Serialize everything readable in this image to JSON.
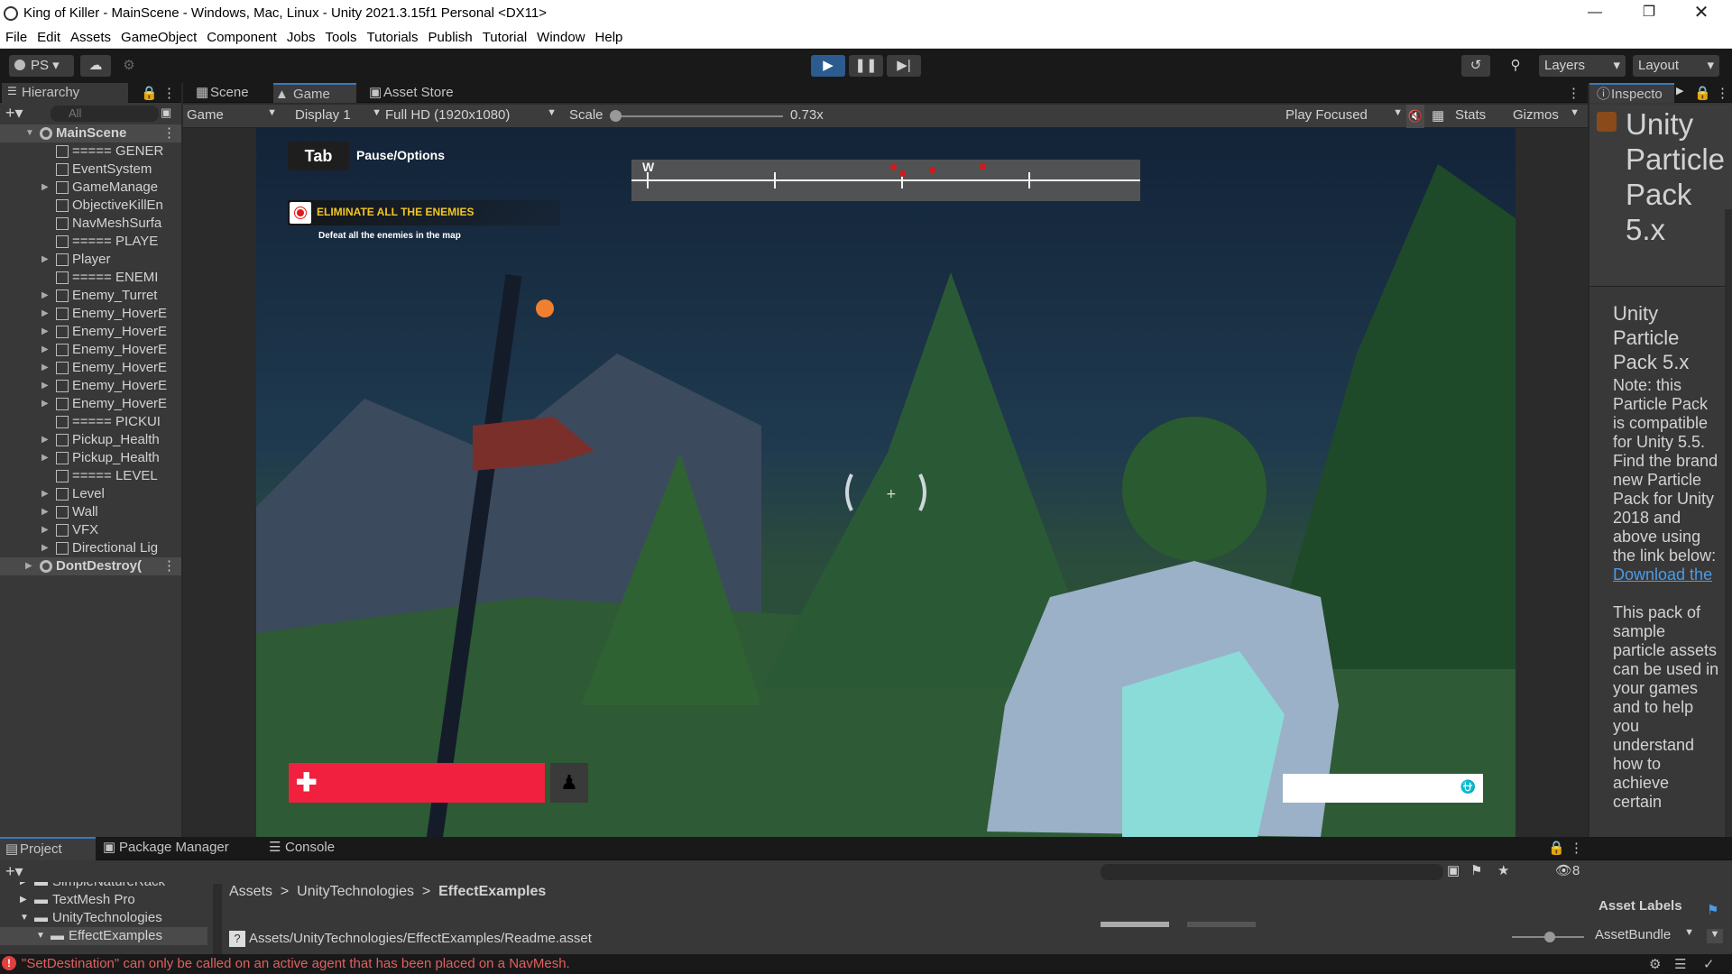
{
  "window": {
    "title": "King of Killer - MainScene - Windows, Mac, Linux - Unity 2021.3.15f1 Personal <DX11>"
  },
  "menu": [
    "File",
    "Edit",
    "Assets",
    "GameObject",
    "Component",
    "Jobs",
    "Tools",
    "Tutorials",
    "Publish",
    "Tutorial",
    "Window",
    "Help"
  ],
  "toolbar": {
    "account": "PS",
    "layers": "Layers",
    "layout": "Layout"
  },
  "hierarchy": {
    "tab": "Hierarchy",
    "search_placeholder": "All",
    "items": [
      {
        "label": "MainScene",
        "indent": 0,
        "expand": "open",
        "icon": "unity"
      },
      {
        "label": "===== GENER",
        "indent": 2,
        "expand": "none",
        "icon": "cube"
      },
      {
        "label": "EventSystem",
        "indent": 2,
        "expand": "none",
        "icon": "cube"
      },
      {
        "label": "GameManage",
        "indent": 2,
        "expand": "closed",
        "icon": "cube"
      },
      {
        "label": "ObjectiveKillEn",
        "indent": 2,
        "expand": "none",
        "icon": "cube"
      },
      {
        "label": "NavMeshSurfa",
        "indent": 2,
        "expand": "none",
        "icon": "cube"
      },
      {
        "label": "===== PLAYE",
        "indent": 2,
        "expand": "none",
        "icon": "cube"
      },
      {
        "label": "Player",
        "indent": 2,
        "expand": "closed",
        "icon": "cube"
      },
      {
        "label": "===== ENEMI",
        "indent": 2,
        "expand": "none",
        "icon": "cube"
      },
      {
        "label": "Enemy_Turret",
        "indent": 2,
        "expand": "closed",
        "icon": "cube"
      },
      {
        "label": "Enemy_HoverE",
        "indent": 2,
        "expand": "closed",
        "icon": "cube"
      },
      {
        "label": "Enemy_HoverE",
        "indent": 2,
        "expand": "closed",
        "icon": "cube"
      },
      {
        "label": "Enemy_HoverE",
        "indent": 2,
        "expand": "closed",
        "icon": "cube"
      },
      {
        "label": "Enemy_HoverE",
        "indent": 2,
        "expand": "closed",
        "icon": "cube"
      },
      {
        "label": "Enemy_HoverE",
        "indent": 2,
        "expand": "closed",
        "icon": "cube"
      },
      {
        "label": "Enemy_HoverE",
        "indent": 2,
        "expand": "closed",
        "icon": "cube"
      },
      {
        "label": "===== PICKUI",
        "indent": 2,
        "expand": "none",
        "icon": "cube"
      },
      {
        "label": "Pickup_Health",
        "indent": 2,
        "expand": "closed",
        "icon": "cube"
      },
      {
        "label": "Pickup_Health",
        "indent": 2,
        "expand": "closed",
        "icon": "cube"
      },
      {
        "label": "===== LEVEL",
        "indent": 2,
        "expand": "none",
        "icon": "cube"
      },
      {
        "label": "Level",
        "indent": 2,
        "expand": "closed",
        "icon": "cube"
      },
      {
        "label": "Wall",
        "indent": 2,
        "expand": "closed",
        "icon": "cube"
      },
      {
        "label": "VFX",
        "indent": 2,
        "expand": "closed",
        "icon": "cube"
      },
      {
        "label": "Directional Lig",
        "indent": 2,
        "expand": "closed",
        "icon": "cube"
      },
      {
        "label": "DontDestroy(",
        "indent": 0,
        "expand": "closed",
        "icon": "unity"
      }
    ]
  },
  "view_tabs": {
    "scene": "Scene",
    "game": "Game",
    "asset_store": "Asset Store"
  },
  "game_toolbar": {
    "mode": "Game",
    "display": "Display 1",
    "resolution": "Full HD (1920x1080)",
    "scale_label": "Scale",
    "scale_value": "0.73x",
    "scale_fraction": 0.0,
    "play_focused": "Play Focused",
    "stats": "Stats",
    "gizmos": "Gizmos"
  },
  "hud": {
    "tab_key": "Tab",
    "pause_label": "Pause/Options",
    "compass_letter": "W",
    "objective_title": "ELIMINATE ALL THE ENEMIES",
    "objective_desc": "Defeat all the enemies in the map",
    "health_fraction": 1.0,
    "ammo_fraction": 1.0,
    "colors": {
      "health": "#f0203e",
      "objective": "#f3c623",
      "enemy_marker": "#e01818"
    }
  },
  "inspector": {
    "tab": "Inspecto",
    "asset_title": "Unity Particle Pack 5.x",
    "subtitle": "Unity Particle Pack 5.x",
    "note": "Note: this Particle Pack is compatible for Unity 5.5. Find the brand new Particle Pack for Unity 2018 and above using the link below:",
    "link": "Download the",
    "description": "This pack of sample particle assets can be used in your games and to help you understand how to achieve certain",
    "asset_labels": "Asset Labels",
    "asset_bundle": "AssetBundle"
  },
  "bottom": {
    "tabs": {
      "project": "Project",
      "package_manager": "Package Manager",
      "console": "Console"
    },
    "tree": [
      {
        "label": "SimpleNatureRack",
        "indent": 1
      },
      {
        "label": "TextMesh Pro",
        "indent": 1
      },
      {
        "label": "UnityTechnologies",
        "indent": 1
      },
      {
        "label": "EffectExamples",
        "indent": 2
      }
    ],
    "breadcrumb": [
      "Assets",
      "UnityTechnologies",
      "EffectExamples"
    ],
    "selected_path": "Assets/UnityTechnologies/EffectExamples/Readme.asset",
    "hidden_count": "8"
  },
  "status": {
    "message": "\"SetDestination\" can only be called on an active agent that has been placed on a NavMesh."
  }
}
